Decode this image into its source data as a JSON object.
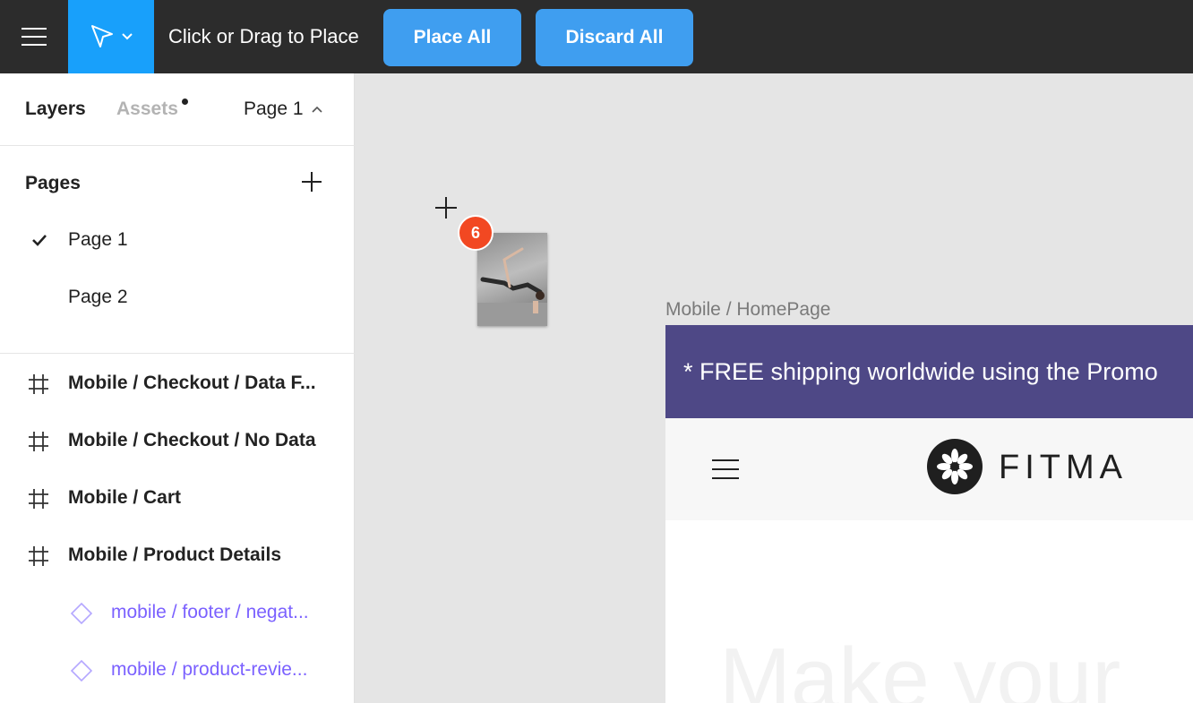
{
  "toolbar": {
    "menu_icon": "hamburger-icon",
    "tool_icon": "move-pointer-icon",
    "place_hint": "Click or Drag to Place",
    "place_all": "Place All",
    "discard_all": "Discard All"
  },
  "sidebar": {
    "tabs": {
      "layers": "Layers",
      "assets": "Assets"
    },
    "current_page": "Page 1",
    "pages_title": "Pages",
    "pages": [
      {
        "label": "Page 1",
        "selected": true
      },
      {
        "label": "Page 2",
        "selected": false
      }
    ],
    "layers": [
      {
        "label": "Mobile / Checkout / Data F...",
        "type": "frame"
      },
      {
        "label": "Mobile / Checkout / No Data",
        "type": "frame"
      },
      {
        "label": "Mobile / Cart",
        "type": "frame"
      },
      {
        "label": "Mobile / Product Details",
        "type": "frame"
      },
      {
        "label": "mobile / footer / negat...",
        "type": "component"
      },
      {
        "label": "mobile / product-revie...",
        "type": "component"
      }
    ]
  },
  "canvas": {
    "place_count": "6",
    "frame_name": "Mobile / HomePage",
    "promo_text": "* FREE shipping worldwide using the Promo",
    "brand": "FITMA",
    "hero_text": "Make your"
  },
  "colors": {
    "toolbar_bg": "#2c2c2c",
    "accent": "#18a0fb",
    "button": "#3f9ef0",
    "component": "#7b61ff",
    "promo_bg": "#4e4886",
    "badge": "#f24822"
  }
}
